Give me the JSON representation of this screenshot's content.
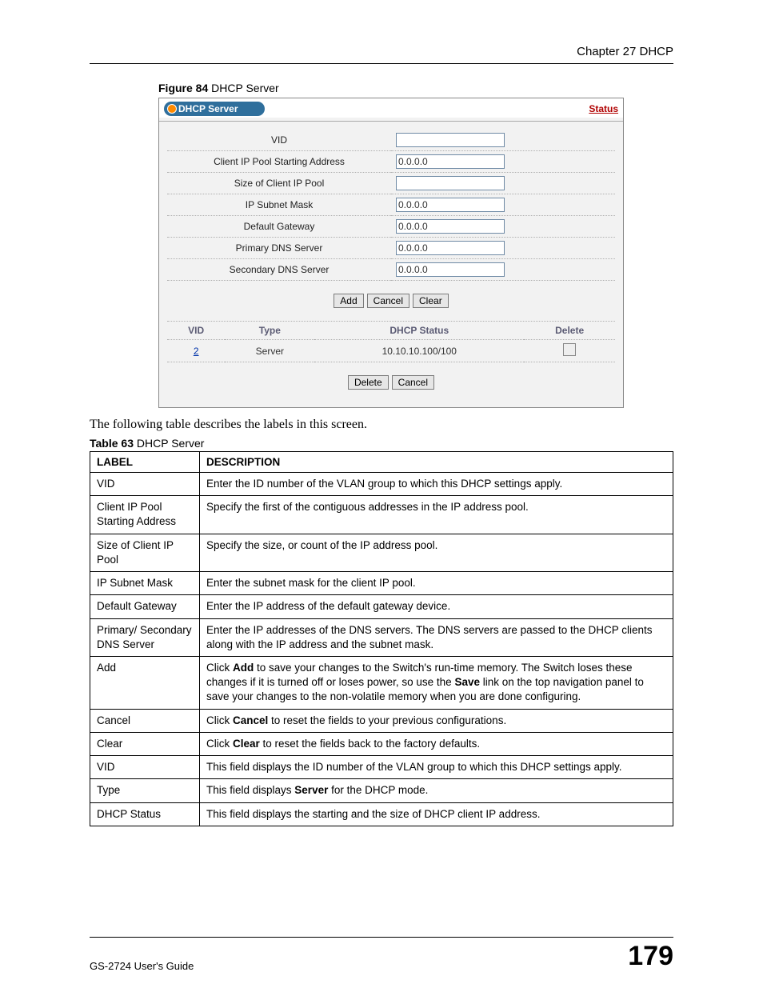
{
  "chapter_header": "Chapter 27 DHCP",
  "figure": {
    "caption_bold": "Figure 84",
    "caption_rest": "   DHCP Server"
  },
  "screenshot": {
    "title": "DHCP Server",
    "status_link": "Status",
    "form": {
      "vid": {
        "label": "VID",
        "value": ""
      },
      "pool_start": {
        "label": "Client IP Pool Starting Address",
        "value": "0.0.0.0"
      },
      "pool_size": {
        "label": "Size of Client IP Pool",
        "value": ""
      },
      "subnet": {
        "label": "IP Subnet Mask",
        "value": "0.0.0.0"
      },
      "gateway": {
        "label": "Default Gateway",
        "value": "0.0.0.0"
      },
      "dns1": {
        "label": "Primary DNS Server",
        "value": "0.0.0.0"
      },
      "dns2": {
        "label": "Secondary DNS Server",
        "value": "0.0.0.0"
      }
    },
    "buttons_top": {
      "add": "Add",
      "cancel": "Cancel",
      "clear": "Clear"
    },
    "list": {
      "headers": {
        "vid": "VID",
        "type": "Type",
        "status": "DHCP Status",
        "delete": "Delete"
      },
      "row": {
        "vid": "2",
        "type": "Server",
        "status": "10.10.10.100/100"
      }
    },
    "buttons_bottom": {
      "delete": "Delete",
      "cancel": "Cancel"
    }
  },
  "body_text": "The following table describes the labels in this screen.",
  "table_caption": {
    "bold": "Table 63",
    "rest": "   DHCP Server"
  },
  "doc_table": {
    "head": {
      "label": "LABEL",
      "desc": "DESCRIPTION"
    },
    "rows": [
      {
        "label": "VID",
        "desc": "Enter the ID number of the VLAN group to which this DHCP settings apply."
      },
      {
        "label": "Client IP Pool Starting Address",
        "desc": "Specify the first of the contiguous addresses in the IP address pool."
      },
      {
        "label": "Size of Client IP Pool",
        "desc": "Specify the size, or count of the IP address pool."
      },
      {
        "label": "IP Subnet Mask",
        "desc": "Enter the subnet mask for the client IP pool."
      },
      {
        "label": "Default Gateway",
        "desc": "Enter the IP address of the default gateway device."
      },
      {
        "label": "Primary/ Secondary DNS Server",
        "desc": "Enter the IP addresses of the DNS servers. The DNS servers are passed to the DHCP clients along with the IP address and the subnet mask."
      },
      {
        "label": "Add",
        "desc": "Click <b>Add</b> to save your changes to the Switch's run-time memory. The Switch loses these changes if it is turned off or loses power, so use the <b>Save</b> link on the top navigation panel to save your changes to the non-volatile memory when you are done configuring."
      },
      {
        "label": "Cancel",
        "desc": "Click <b>Cancel</b> to reset the fields to your previous configurations."
      },
      {
        "label": "Clear",
        "desc": "Click <b>Clear</b> to reset the fields back to the factory defaults."
      },
      {
        "label": "VID",
        "desc": "This field displays the ID number of the VLAN group to which this DHCP settings apply."
      },
      {
        "label": "Type",
        "desc": "This field displays <b>Server</b> for the DHCP mode."
      },
      {
        "label": "DHCP Status",
        "desc": "This field displays the starting and the size of DHCP client IP address."
      }
    ]
  },
  "footer": {
    "guide": "GS-2724 User's Guide",
    "page": "179"
  }
}
